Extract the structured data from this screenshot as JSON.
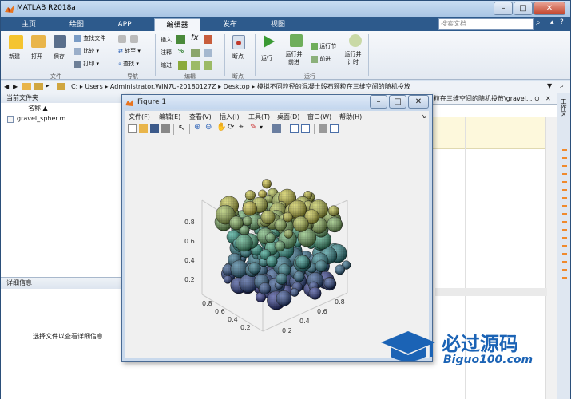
{
  "window": {
    "title": "MATLAB R2018a"
  },
  "tabs": [
    "主页",
    "绘图",
    "APP",
    "编辑器",
    "发布",
    "视图"
  ],
  "search": {
    "placeholder": "搜索文档"
  },
  "ribbon": {
    "file": {
      "new": "新建",
      "open": "打开",
      "save": "保存",
      "find_files": "查找文件",
      "compare": "比较",
      "print": "打印",
      "group": "文件"
    },
    "nav": {
      "goto": "转至",
      "find": "查找",
      "group": "导航"
    },
    "edit": {
      "insert": "插入",
      "comment": "注释",
      "indent": "缩进",
      "fx": "fx",
      "group": "编辑"
    },
    "breakpoints": {
      "label": "断点",
      "group": "断点"
    },
    "run": {
      "run": "运行",
      "run_advance_1": "运行并",
      "run_advance_2": "前进",
      "run_section": "运行节",
      "advance": "前进",
      "run_time_1": "运行并",
      "run_time_2": "计时",
      "group": "运行"
    }
  },
  "address": {
    "path": [
      "C:",
      "Users",
      "Administrator.WIN7U-20180127Z",
      "Desktop",
      "模拟不同粒径的混凝土骰石颗粒在三维空间的随机投放"
    ]
  },
  "current_folder": {
    "title": "当前文件夹",
    "col_name": "名称",
    "files": [
      "gravel_spher.m"
    ]
  },
  "details": {
    "title": "详细信息",
    "hint": "选择文件以查看详细信息"
  },
  "editor_tab": {
    "label": "粒在三维空间的随机投放\\gravel..."
  },
  "sidebar_label": "工作区",
  "figure": {
    "title": "Figure 1",
    "menu": [
      "文件(F)",
      "编辑(E)",
      "查看(V)",
      "插入(I)",
      "工具(T)",
      "桌面(D)",
      "窗口(W)",
      "帮助(H)"
    ]
  },
  "chart_data": {
    "type": "scatter",
    "title": "",
    "z_ticks": [
      "0.2",
      "0.4",
      "0.6",
      "0.8"
    ],
    "x_ticks": [
      "0.2",
      "0.4",
      "0.6",
      "0.8"
    ],
    "y_ticks": [
      "0.2",
      "0.4",
      "0.6",
      "0.8"
    ],
    "zlim": [
      0.1,
      0.9
    ],
    "colors": {
      "low": "#2b2f8f",
      "mid": "#2ca58d",
      "high": "#d9c936"
    }
  },
  "watermark": {
    "text": "必过源码",
    "url": "Biguo100.com"
  },
  "colors": {
    "tabstrip": "#2d5a8c",
    "ribbon": "#e9eef5"
  }
}
